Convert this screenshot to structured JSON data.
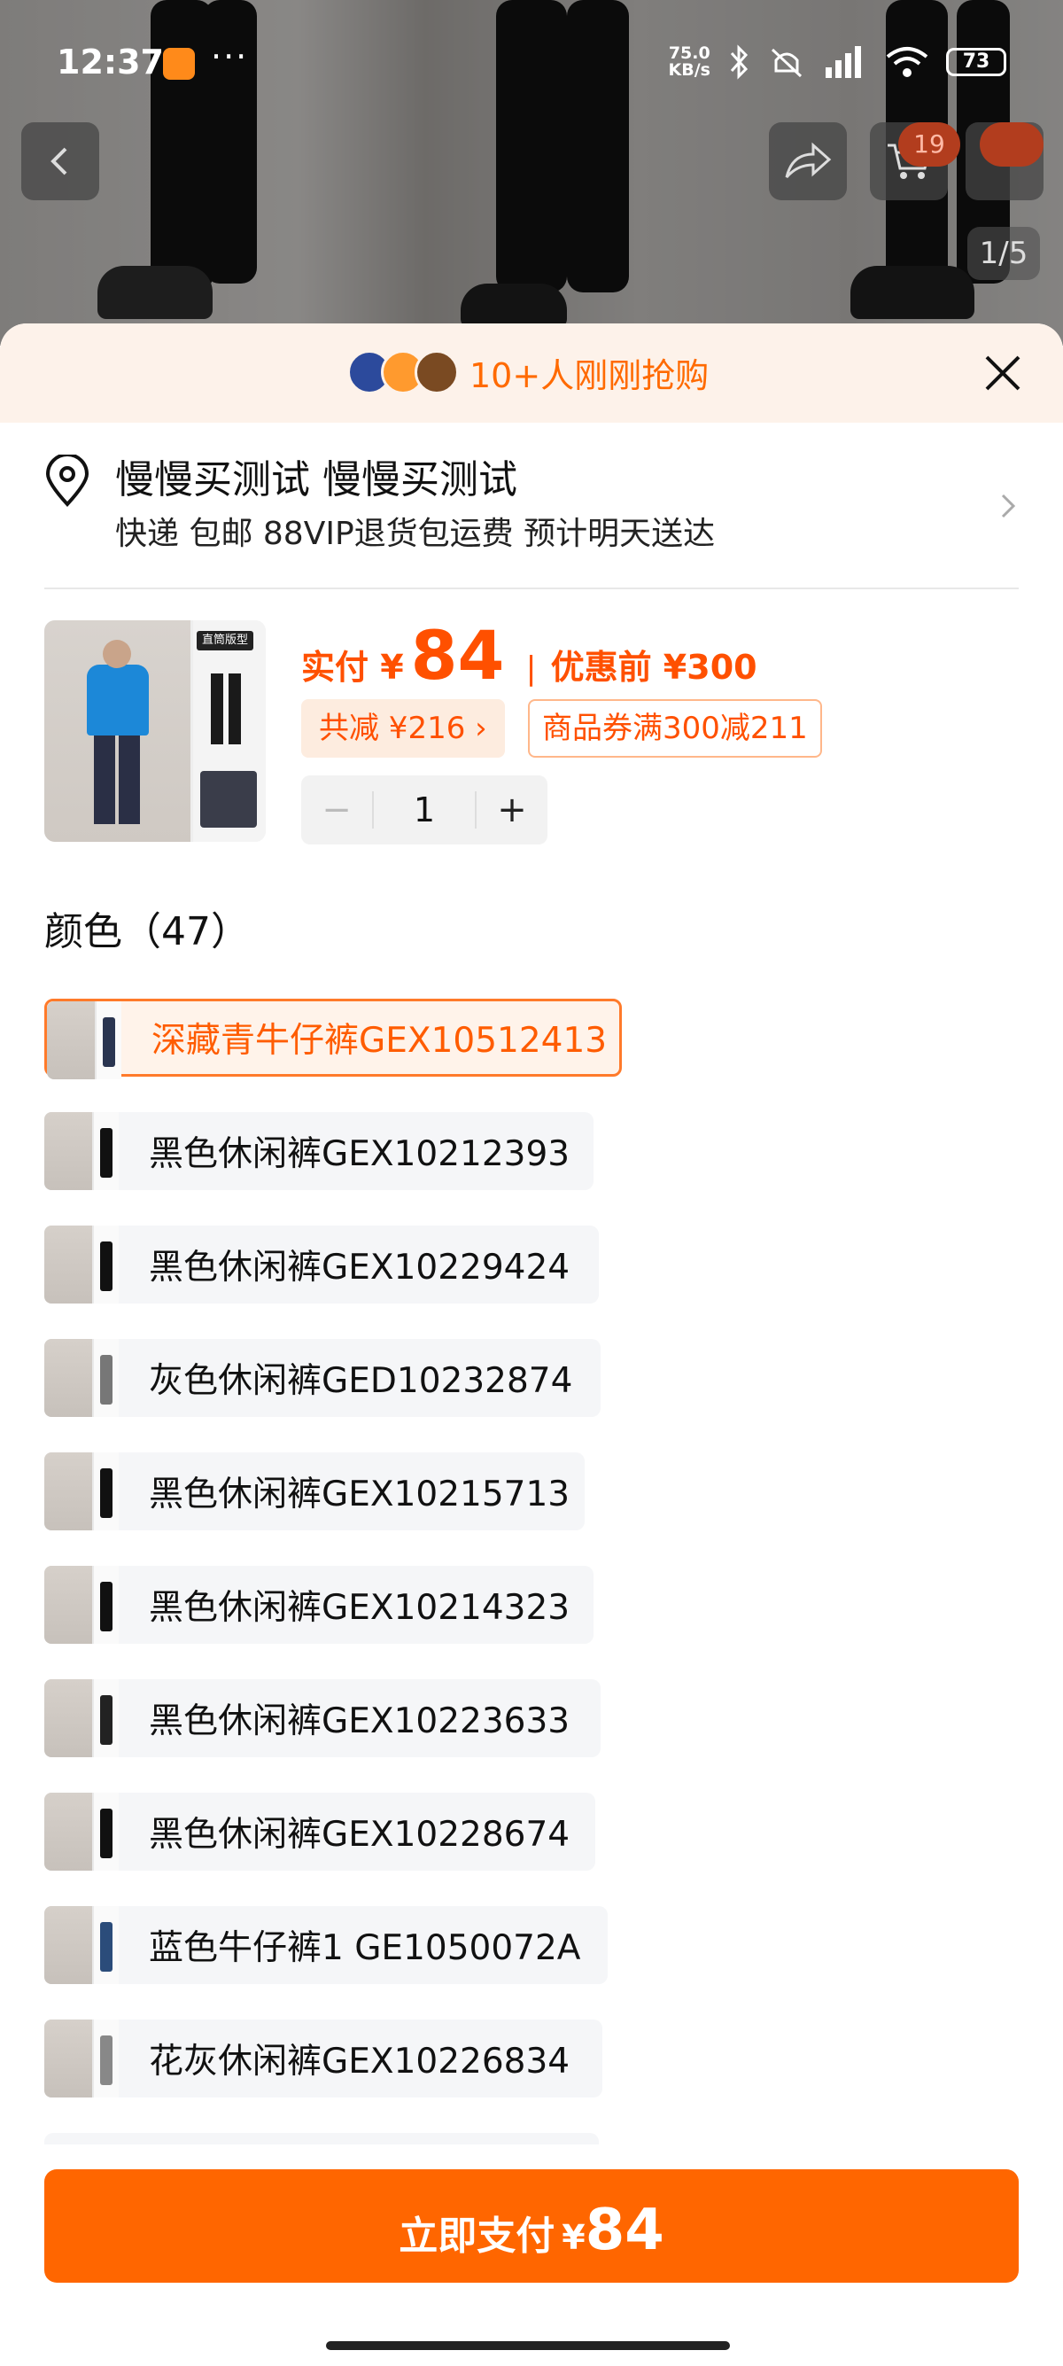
{
  "status_bar": {
    "time": "12:37",
    "more": "···",
    "speed_value": "75.0",
    "speed_unit": "KB/s",
    "battery": "73"
  },
  "top_nav": {
    "cart_count": "19",
    "page_indicator": "1/5"
  },
  "banner": {
    "text": "10+人刚刚抢购"
  },
  "address": {
    "name": "慢慢买测试 慢慢买测试",
    "delivery": "快递 包邮 88VIP退货包运费 预计明天送达"
  },
  "product": {
    "thumb_tag": "直筒版型",
    "price_prefix": "实付 ¥",
    "price": "84",
    "separator": "|",
    "original_label": "优惠前 ¥300",
    "reduce_chip": "共减 ¥216 ›",
    "coupon_chip": "商品券满300减211",
    "quantity": "1",
    "minus": "−",
    "plus": "+"
  },
  "colors": {
    "title": "颜色（47）",
    "options": [
      {
        "label": "深藏青牛仔裤GEX10512413",
        "selected": true
      },
      {
        "label": "黑色休闲裤GEX10212393",
        "selected": false
      },
      {
        "label": "黑色休闲裤GEX10229424",
        "selected": false
      },
      {
        "label": "灰色休闲裤GED10232874",
        "selected": false
      },
      {
        "label": "黑色休闲裤GEX10215713",
        "selected": false
      },
      {
        "label": "黑色休闲裤GEX10214323",
        "selected": false
      },
      {
        "label": "黑色休闲裤GEX10223633",
        "selected": false
      },
      {
        "label": "黑色休闲裤GEX10228674",
        "selected": false
      },
      {
        "label": "蓝色牛仔裤1 GE1050072A",
        "selected": false
      },
      {
        "label": "花灰休闲裤GEX10226834",
        "selected": false
      }
    ]
  },
  "pay_button": {
    "label": "立即支付",
    "currency": "¥",
    "amount": "84"
  },
  "colors_theme": {
    "accent": "#ff6600",
    "price": "#ff5000"
  }
}
